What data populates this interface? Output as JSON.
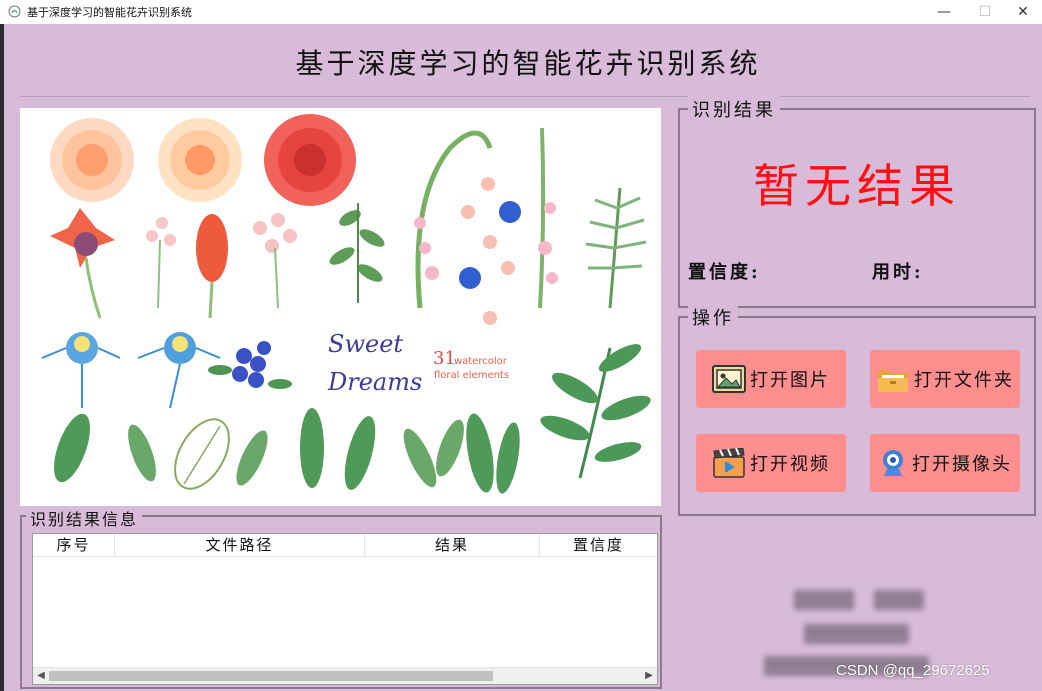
{
  "window": {
    "title": "基于深度学习的智能花卉识别系统",
    "controls": {
      "minimize": "—",
      "maximize": "☐",
      "close": "✕"
    }
  },
  "header": {
    "title": "基于深度学习的智能花卉识别系统"
  },
  "image_panel": {
    "text_sweet": "Sweet",
    "text_dreams": "Dreams",
    "text_31": "31",
    "text_watercolor": "watercolor",
    "text_floral": "floral elements"
  },
  "result": {
    "group_title": "识别结果",
    "status_text": "暂无结果",
    "confidence_label": "置信度:",
    "time_label": "用时:"
  },
  "operations": {
    "group_title": "操作",
    "buttons": [
      {
        "label": "打开图片",
        "icon": "image-icon"
      },
      {
        "label": "打开文件夹",
        "icon": "folder-icon"
      },
      {
        "label": "打开视频",
        "icon": "video-icon"
      },
      {
        "label": "打开摄像头",
        "icon": "camera-icon"
      }
    ]
  },
  "info": {
    "group_title": "识别结果信息",
    "columns": [
      "序号",
      "文件路径",
      "结果",
      "置信度"
    ],
    "rows": []
  },
  "footer": {
    "watermark": "CSDN @qq_29672625"
  },
  "colors": {
    "background": "#d8bbd9",
    "button": "#ff8f8f",
    "no_result": "#ff1010"
  }
}
